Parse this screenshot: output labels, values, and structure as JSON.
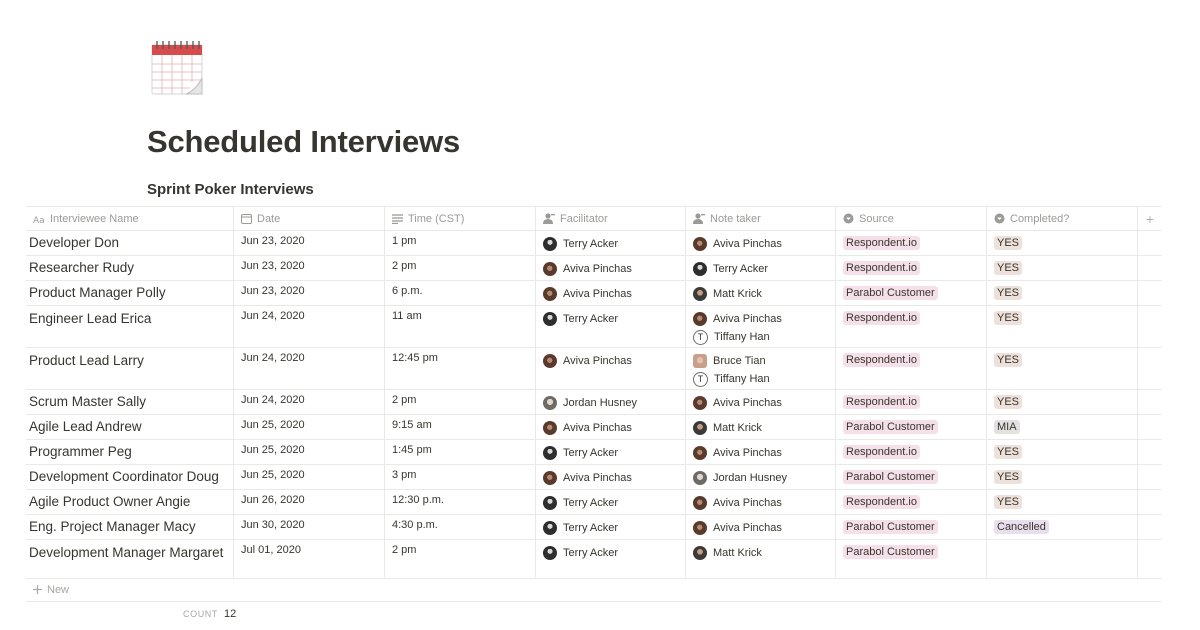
{
  "page": {
    "icon": "calendar-emoji-icon",
    "title": "Scheduled Interviews"
  },
  "database": {
    "title": "Sprint Poker Interviews",
    "columns": [
      {
        "label": "Interviewee Name",
        "icon": "title-property-icon"
      },
      {
        "label": "Date",
        "icon": "calendar-property-icon"
      },
      {
        "label": "Time (CST)",
        "icon": "text-property-icon"
      },
      {
        "label": "Facilitator",
        "icon": "person-property-icon"
      },
      {
        "label": "Note taker",
        "icon": "person-property-icon"
      },
      {
        "label": "Source",
        "icon": "select-property-icon"
      },
      {
        "label": "Completed?",
        "icon": "select-property-icon"
      }
    ],
    "add_column_label": "+",
    "rows": [
      {
        "name": "Developer Don",
        "date": "Jun 23, 2020",
        "time": "1 pm",
        "facilitator": [
          {
            "name": "Terry Acker",
            "avatar": "ta"
          }
        ],
        "note_taker": [
          {
            "name": "Aviva Pinchas",
            "avatar": "ap"
          }
        ],
        "source": "Respondent.io",
        "completed": "YES"
      },
      {
        "name": "Researcher Rudy",
        "date": "Jun 23, 2020",
        "time": "2 pm",
        "facilitator": [
          {
            "name": "Aviva Pinchas",
            "avatar": "ap"
          }
        ],
        "note_taker": [
          {
            "name": "Terry Acker",
            "avatar": "ta"
          }
        ],
        "source": "Respondent.io",
        "completed": "YES"
      },
      {
        "name": "Product Manager Polly",
        "date": "Jun 23, 2020",
        "time": "6 p.m.",
        "facilitator": [
          {
            "name": "Aviva Pinchas",
            "avatar": "ap"
          }
        ],
        "note_taker": [
          {
            "name": "Matt Krick",
            "avatar": "mk"
          }
        ],
        "source": "Parabol Customer",
        "completed": "YES"
      },
      {
        "name": "Engineer Lead Erica",
        "date": "Jun 24, 2020",
        "time": "11 am",
        "facilitator": [
          {
            "name": "Terry Acker",
            "avatar": "ta"
          }
        ],
        "note_taker": [
          {
            "name": "Aviva Pinchas",
            "avatar": "ap"
          },
          {
            "name": "Tiffany Han",
            "avatar": "th",
            "initial": "T"
          }
        ],
        "source": "Respondent.io",
        "completed": "YES"
      },
      {
        "name": "Product Lead Larry",
        "date": "Jun 24, 2020",
        "time": "12:45 pm",
        "facilitator": [
          {
            "name": "Aviva Pinchas",
            "avatar": "ap"
          }
        ],
        "note_taker": [
          {
            "name": "Bruce Tian",
            "avatar": "bt"
          },
          {
            "name": "Tiffany Han",
            "avatar": "th",
            "initial": "T"
          }
        ],
        "source": "Respondent.io",
        "completed": "YES"
      },
      {
        "name": "Scrum Master Sally",
        "date": "Jun 24, 2020",
        "time": "2 pm",
        "facilitator": [
          {
            "name": "Jordan Husney",
            "avatar": "jh"
          }
        ],
        "note_taker": [
          {
            "name": "Aviva Pinchas",
            "avatar": "ap"
          }
        ],
        "source": "Respondent.io",
        "completed": "YES"
      },
      {
        "name": "Agile Lead Andrew",
        "date": "Jun 25, 2020",
        "time": "9:15 am",
        "facilitator": [
          {
            "name": "Aviva Pinchas",
            "avatar": "ap"
          }
        ],
        "note_taker": [
          {
            "name": "Matt Krick",
            "avatar": "mk"
          }
        ],
        "source": "Parabol Customer",
        "completed": "MIA"
      },
      {
        "name": "Programmer Peg",
        "date": "Jun 25, 2020",
        "time": "1:45 pm",
        "facilitator": [
          {
            "name": "Terry Acker",
            "avatar": "ta"
          }
        ],
        "note_taker": [
          {
            "name": "Aviva Pinchas",
            "avatar": "ap"
          }
        ],
        "source": "Respondent.io",
        "completed": "YES"
      },
      {
        "name": "Development Coordinator Doug",
        "date": "Jun 25, 2020",
        "time": "3 pm",
        "facilitator": [
          {
            "name": "Aviva Pinchas",
            "avatar": "ap"
          }
        ],
        "note_taker": [
          {
            "name": "Jordan Husney",
            "avatar": "jh"
          }
        ],
        "source": "Parabol Customer",
        "completed": "YES"
      },
      {
        "name": "Agile Product Owner Angie",
        "date": "Jun 26, 2020",
        "time": "12:30 p.m.",
        "facilitator": [
          {
            "name": "Terry Acker",
            "avatar": "ta"
          }
        ],
        "note_taker": [
          {
            "name": "Aviva Pinchas",
            "avatar": "ap"
          }
        ],
        "source": "Respondent.io",
        "completed": "YES"
      },
      {
        "name": "Eng. Project Manager Macy",
        "date": "Jun 30, 2020",
        "time": "4:30 p.m.",
        "facilitator": [
          {
            "name": "Terry Acker",
            "avatar": "ta"
          }
        ],
        "note_taker": [
          {
            "name": "Aviva Pinchas",
            "avatar": "ap"
          }
        ],
        "source": "Parabol Customer",
        "completed": "Cancelled"
      },
      {
        "name": "Development Manager Margaret",
        "date": "Jul 01, 2020",
        "time": "2 pm",
        "facilitator": [
          {
            "name": "Terry Acker",
            "avatar": "ta"
          }
        ],
        "note_taker": [
          {
            "name": "Matt Krick",
            "avatar": "mk"
          }
        ],
        "source": "Parabol Customer",
        "completed": ""
      }
    ],
    "new_row_label": "New",
    "count_label": "COUNT",
    "count_value": "12"
  },
  "colors": {
    "text": "#37352f",
    "muted": "#9b9a97",
    "border": "#e9e9e7",
    "tag_respondent": "#f5e0e9",
    "tag_parabol": "#f5e0e9",
    "tag_yes": "#eee0da",
    "tag_mia": "#e3e2e0",
    "tag_cancelled": "#e8deee"
  }
}
